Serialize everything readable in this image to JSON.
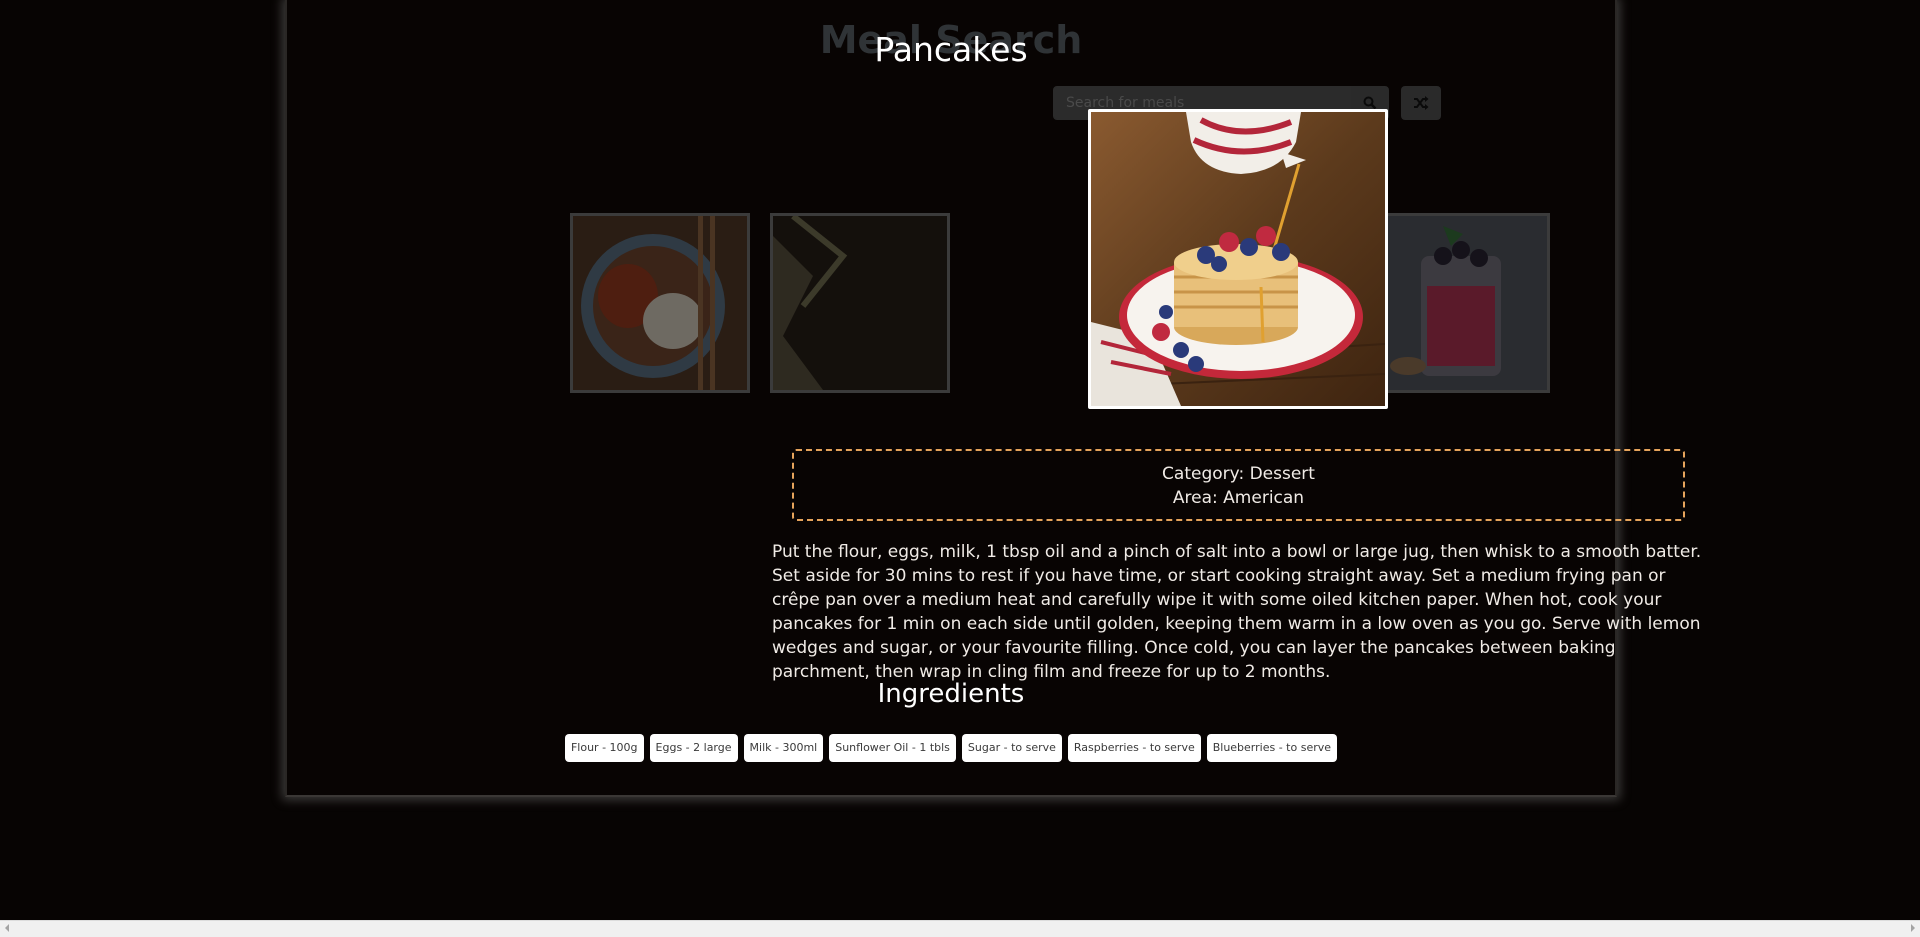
{
  "app": {
    "background_title": "Meal Search"
  },
  "search": {
    "placeholder": "Search for meals",
    "search_icon": "search-icon",
    "random_icon": "shuffle-icon"
  },
  "meal": {
    "title": "Pancakes",
    "category_text": "Category: Dessert",
    "area_text": "Area: American",
    "instructions": "Put the flour, eggs, milk, 1 tbsp oil and a pinch of salt into a bowl or large jug, then whisk to a smooth batter. Set aside for 30 mins to rest if you have time, or start cooking straight away. Set a medium frying pan or crêpe pan over a medium heat and carefully wipe it with some oiled kitchen paper. When hot, cook your pancakes for 1 min on each side until golden, keeping them warm in a low oven as you go. Serve with lemon wedges and sugar, or your favourite filling. Once cold, you can layer the pancakes between baking parchment, then wrap in cling film and freeze for up to 2 months.",
    "ingredients_heading": "Ingredients",
    "ingredients": [
      "Flour - 100g",
      "Eggs - 2 large",
      "Milk - 300ml",
      "Sunflower Oil - 1 tbls",
      "Sugar - to serve",
      "Raspberries - to serve",
      "Blueberries - to serve"
    ]
  },
  "colors": {
    "page_bg": "#070403",
    "info_border": "#e6a45c",
    "chip_bg": "#ffffff"
  }
}
